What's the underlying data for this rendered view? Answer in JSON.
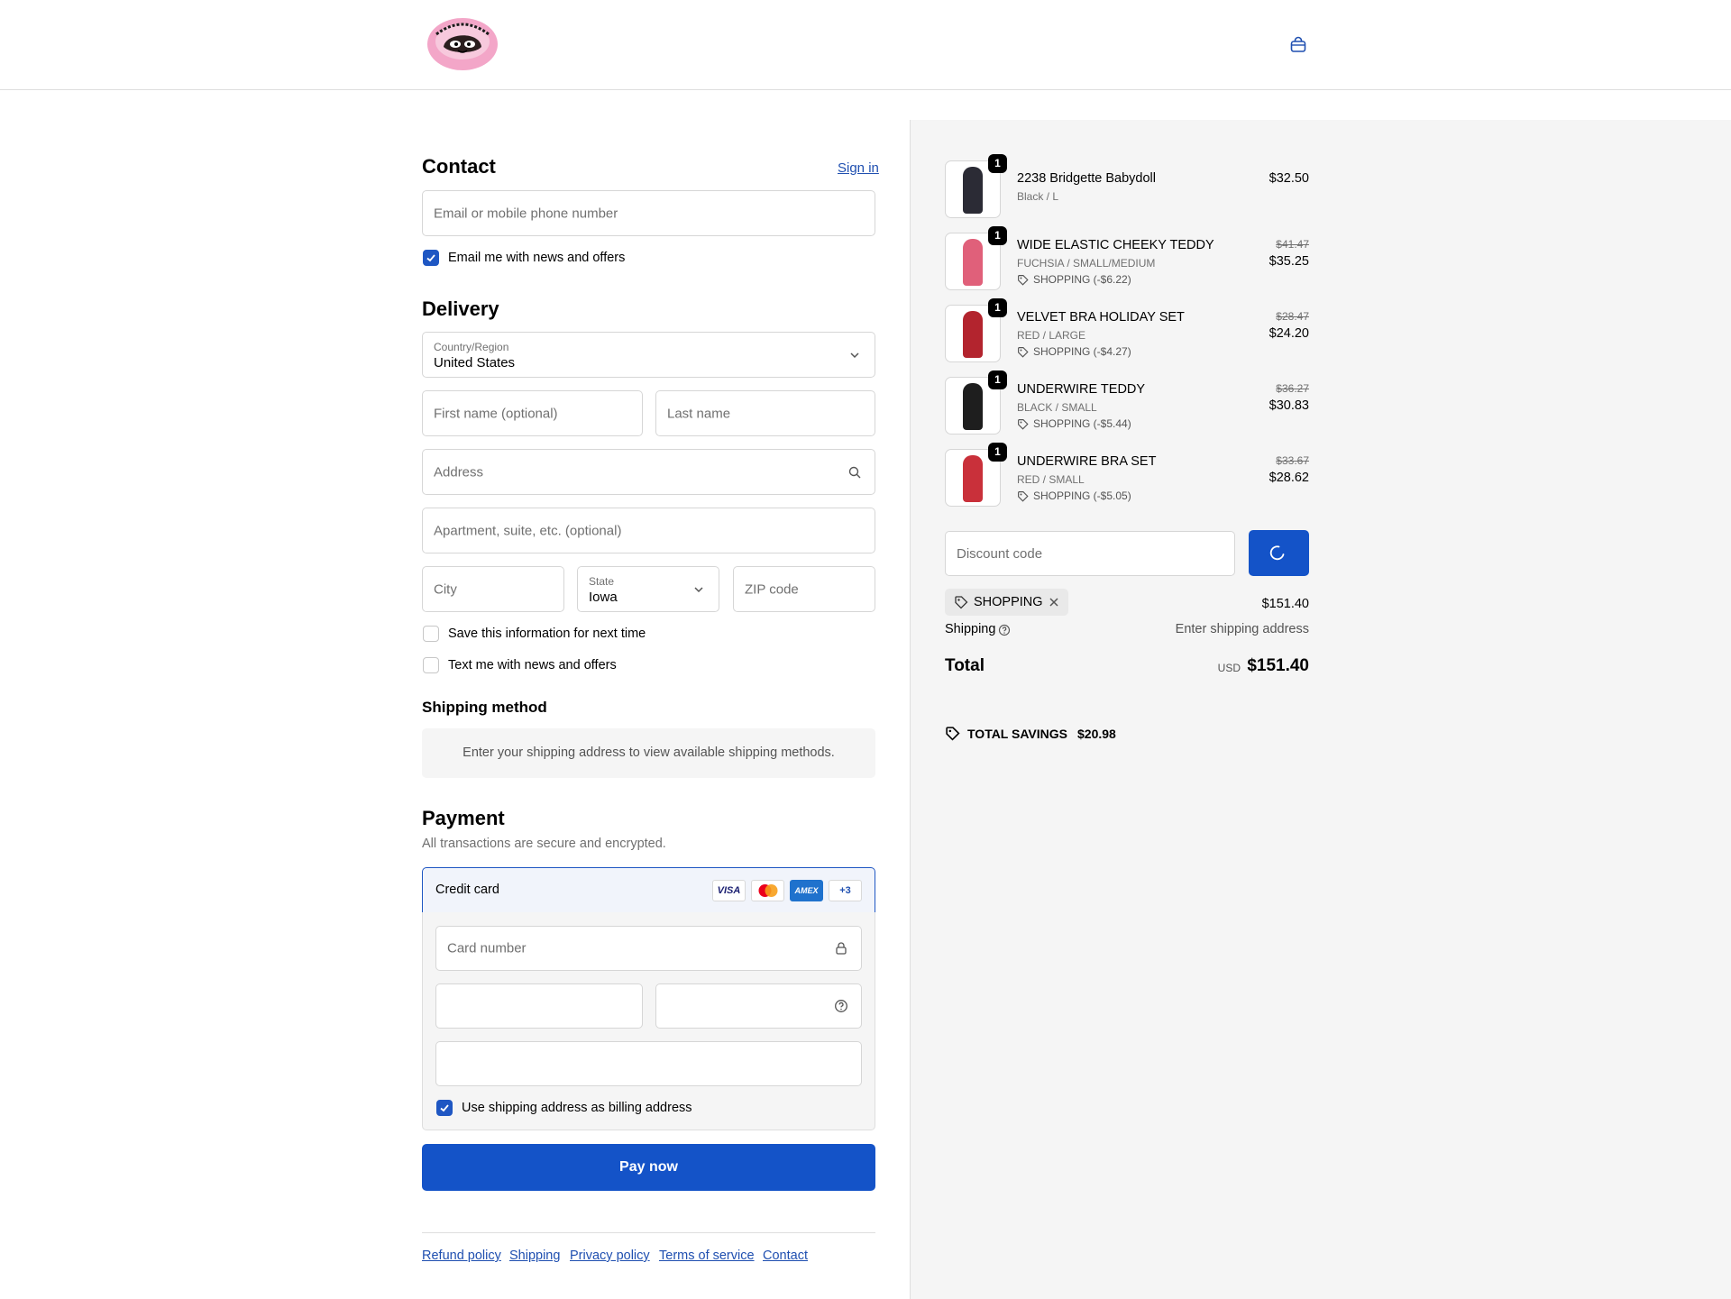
{
  "colors": {
    "accent": "#1453c8",
    "link": "#1f4fb0",
    "panel_bg": "#f5f5f5"
  },
  "header": {
    "logo_icon": "store-logo-image",
    "cart_icon": "shopping-bag-icon"
  },
  "contact": {
    "title": "Contact",
    "sign_in": "Sign in",
    "email_placeholder": "Email or mobile phone number",
    "news_label": "Email me with news and offers",
    "news_checked": true
  },
  "delivery": {
    "title": "Delivery",
    "country_label": "Country/Region",
    "country_value": "United States",
    "first_name_placeholder": "First name (optional)",
    "last_name_placeholder": "Last name",
    "address_placeholder": "Address",
    "apartment_placeholder": "Apartment, suite, etc. (optional)",
    "city_placeholder": "City",
    "state_label": "State",
    "state_value": "Iowa",
    "zip_placeholder": "ZIP code",
    "save_info_label": "Save this information for next time",
    "text_news_label": "Text me with news and offers"
  },
  "shipping_method": {
    "title": "Shipping method",
    "message": "Enter your shipping address to view available shipping methods."
  },
  "payment": {
    "title": "Payment",
    "subtitle": "All transactions are secure and encrypted.",
    "method": "Credit card",
    "card_logos": [
      "VISA",
      "mastercard",
      "AMEX",
      "+3"
    ],
    "card_number_placeholder": "Card number",
    "billing_label": "Use shipping address as billing address",
    "billing_checked": true,
    "pay_button": "Pay now"
  },
  "footer": {
    "links": [
      "Refund policy",
      "Shipping",
      "Privacy policy",
      "Terms of service",
      "Contact"
    ]
  },
  "order": {
    "items": [
      {
        "qty": "1",
        "name": "2238 Bridgette Babydoll",
        "variant": "Black / L",
        "price": "$32.50",
        "thumb_color": "#2b2b35"
      },
      {
        "qty": "1",
        "name": "WIDE ELASTIC CHEEKY TEDDY",
        "variant": "FUCHSIA / SMALL/MEDIUM",
        "discount": "SHOPPING (-$6.22)",
        "old_price": "$41.47",
        "price": "$35.25",
        "thumb_color": "#e0607a"
      },
      {
        "qty": "1",
        "name": "VELVET BRA HOLIDAY SET",
        "variant": "RED / LARGE",
        "discount": "SHOPPING (-$4.27)",
        "old_price": "$28.47",
        "price": "$24.20",
        "thumb_color": "#b3242e"
      },
      {
        "qty": "1",
        "name": "UNDERWIRE TEDDY",
        "variant": "BLACK / SMALL",
        "discount": "SHOPPING (-$5.44)",
        "old_price": "$36.27",
        "price": "$30.83",
        "thumb_color": "#1e1e1e"
      },
      {
        "qty": "1",
        "name": "UNDERWIRE BRA SET",
        "variant": "RED / SMALL",
        "discount": "SHOPPING (-$5.05)",
        "old_price": "$33.67",
        "price": "$28.62",
        "thumb_color": "#c9303a"
      }
    ],
    "discount_placeholder": "Discount code",
    "applied_code": "SHOPPING",
    "subtotal": "$151.40",
    "shipping_label": "Shipping",
    "shipping_value": "Enter shipping address",
    "total_label": "Total",
    "currency": "USD",
    "total": "$151.40",
    "savings_label": "TOTAL SAVINGS",
    "savings_value": "$20.98"
  }
}
